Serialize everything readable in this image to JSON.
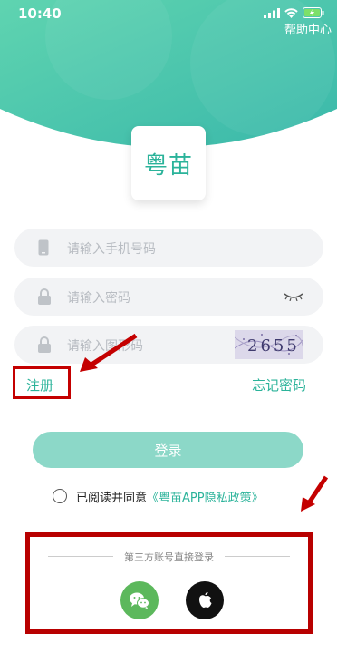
{
  "status_bar": {
    "time": "10:40"
  },
  "header": {
    "help_label": "帮助中心"
  },
  "logo": {
    "text": "粤苗"
  },
  "form": {
    "phone_placeholder": "请输入手机号码",
    "password_placeholder": "请输入密码",
    "captcha_placeholder": "请输入图形码",
    "captcha_text": "2655"
  },
  "links": {
    "register": "注册",
    "forgot": "忘记密码"
  },
  "login_label": "登录",
  "agreement": {
    "prefix": "已阅读并同意",
    "policy": "《粤苗APP隐私政策》"
  },
  "third_party": {
    "title": "第三方账号直接登录",
    "providers": [
      "wechat-icon",
      "apple-icon"
    ]
  },
  "colors": {
    "brand": "#2bb39a",
    "annotation": "#c40000"
  }
}
